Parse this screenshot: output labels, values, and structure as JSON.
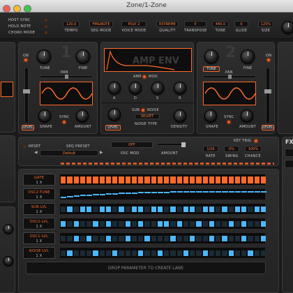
{
  "window": {
    "title": "Zone/1-Zone"
  },
  "top_bar": {
    "mode_toggles": [
      "HOST SYNC",
      "HOLD NOTE",
      "CHORD MODE"
    ],
    "fields": [
      {
        "label": "TEMPO",
        "value": "120.0"
      },
      {
        "label": "SEG MODE",
        "value": "FM&NOTE"
      },
      {
        "label": "VOICE MODE",
        "value": "POLY 2"
      },
      {
        "label": "QUALITY",
        "value": "EXTREME"
      },
      {
        "label": "TRANSPOSE",
        "value": "0"
      },
      {
        "label": "TUNE",
        "value": "440.0"
      },
      {
        "label": "GLIDE",
        "value": "0"
      },
      {
        "label": "SIZE",
        "value": "125%"
      }
    ]
  },
  "osc1": {
    "number": "1",
    "knob_labels": [
      "TUNE",
      "FINE",
      "PAN",
      "SHAPE",
      "SYNC",
      "AMOUNT"
    ],
    "sync_label": "SYNC",
    "level_label": "LEVEL",
    "on_label": "ON"
  },
  "osc2": {
    "number": "2",
    "knob_labels": [
      "TUNE",
      "FINE",
      "PAN",
      "RATE",
      "SHAPE",
      "SYNC",
      "AMOUNT"
    ],
    "sync_label": "SYNC",
    "level_label": "LEVEL",
    "on_label": "ON",
    "mode_button": "TUNE"
  },
  "amp_env": {
    "title": "AMP ENV",
    "toggle_amp": "AMP",
    "toggle_mod": "MOD",
    "knob_labels": [
      "A",
      "D",
      "S",
      "R"
    ],
    "sub_label": "SUB",
    "noise_label": "NOISE",
    "noise_type_value": "VELVET",
    "noise_type_label": "NOISE TYPE",
    "level_label": "LEVEL",
    "density_label": "DENSITY"
  },
  "seq_controls": {
    "reset_label": "RESET",
    "preset_label": "SEQ PRESET",
    "preset_value": "Default",
    "osc_mod_value": "OFF",
    "osc_mod_label": "OSC MOD",
    "amount_label": "AMOUNT",
    "key_trig_label": "KEY TRIG",
    "rate_value": "1/16",
    "rate_label": "RATE",
    "swing_value": "0%",
    "swing_label": "SWING",
    "chance_value": "100%",
    "chance_label": "CHANCE"
  },
  "sequencer": {
    "lanes": [
      {
        "name": "GATE",
        "mult": "1 X"
      },
      {
        "name": "OSC2-TUNE",
        "mult": "1 X"
      },
      {
        "name": "SUB-LVL",
        "mult": "1 X"
      },
      {
        "name": "OSC2-LVL",
        "mult": "1 X"
      },
      {
        "name": "OSC1-LVL",
        "mult": "1 X"
      },
      {
        "name": "NOISE-LVL",
        "mult": "1 X"
      }
    ],
    "drop_hint": "DROP PARAMETER TO CREATE LANE"
  },
  "right_side": {
    "fx_label": "FX"
  },
  "colors": {
    "accent": "#ff6a2a",
    "cell_blue": "#4cb8ff",
    "background": "#1a1a1a"
  }
}
